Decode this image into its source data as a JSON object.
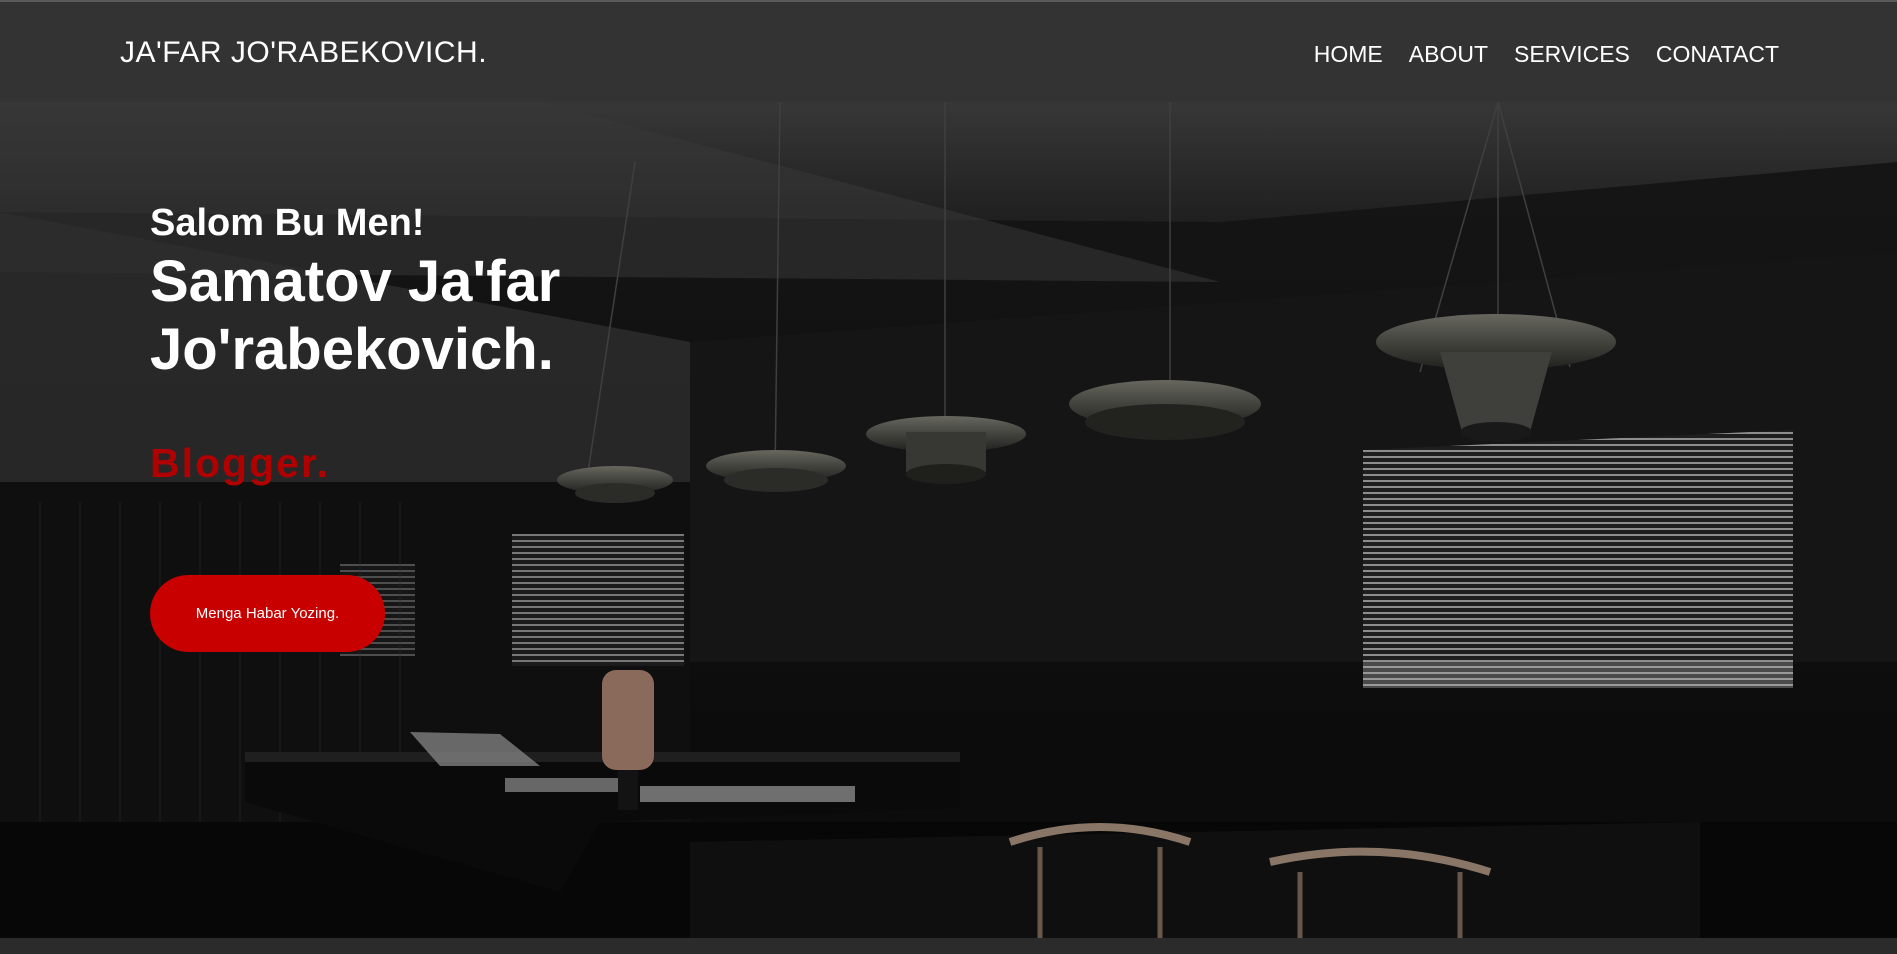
{
  "header": {
    "brand": "JA'FAR JO'RABEKOVICH.",
    "nav": [
      "HOME",
      "ABOUT",
      "SERVICES",
      "CONATACT"
    ]
  },
  "hero": {
    "greeting": "Salom Bu Men!",
    "name_line1": "Samatov Ja'far",
    "name_line2": "Jo'rabekovich.",
    "role": "Blogger.",
    "cta_label": "Menga Habar Yozing."
  },
  "colors": {
    "navbar": "#333333",
    "accent": "#c90000",
    "role_text": "#b00000"
  }
}
